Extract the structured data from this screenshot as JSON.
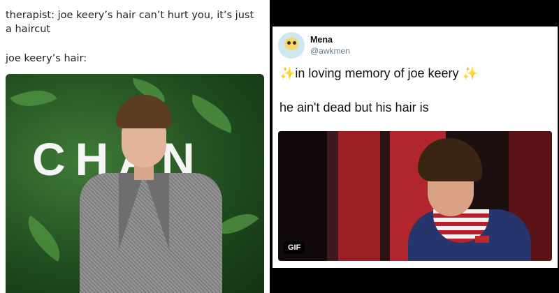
{
  "left": {
    "caption_line1": "therapist: joe keery’s hair can’t hurt you, it’s just a haircut",
    "caption_line2": "joe keery’s hair:",
    "photo_brand_text": "CHAN"
  },
  "tweet": {
    "author_name": "Mena",
    "author_handle": "@awkmen",
    "sparkle": "✨",
    "line1": "in loving memory of joe keery",
    "line2": "he ain't dead but his hair is",
    "media_badge": "GIF"
  },
  "colors": {
    "background": "#000000",
    "panel": "#ffffff",
    "handle": "#657786",
    "sparkle": "#f5b301"
  }
}
